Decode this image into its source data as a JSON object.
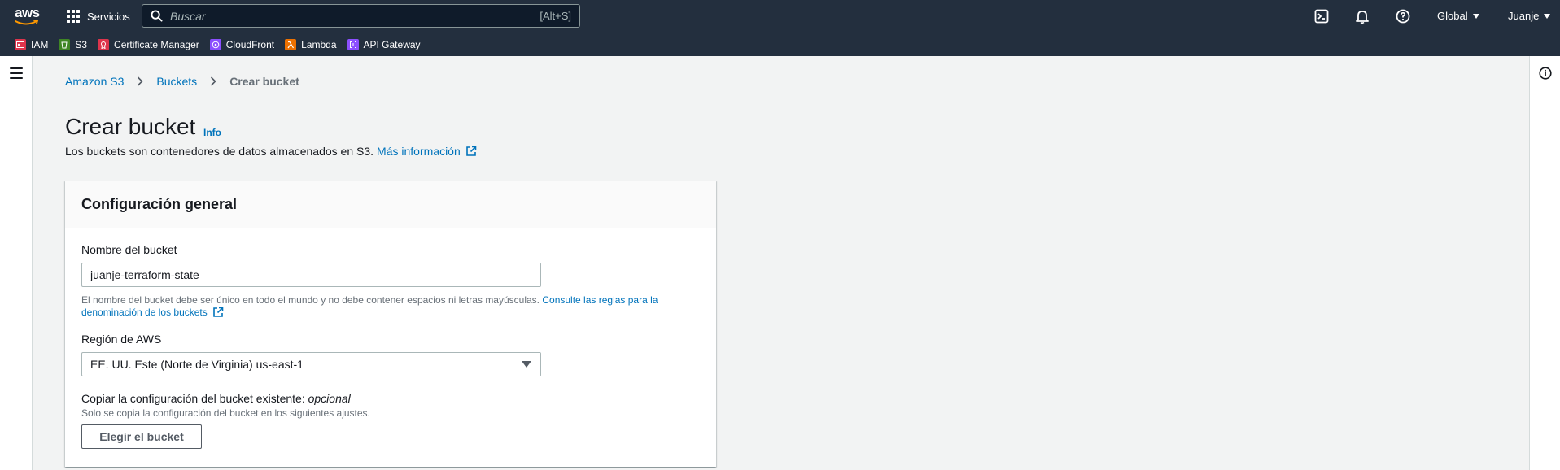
{
  "topnav": {
    "logo": "aws",
    "services_label": "Servicios",
    "search_placeholder": "Buscar",
    "search_shortcut": "[Alt+S]",
    "region": "Global",
    "user": "Juanje"
  },
  "favorites": [
    {
      "label": "IAM",
      "color": "#dd344c",
      "icon": "iam-icon"
    },
    {
      "label": "S3",
      "color": "#3f8624",
      "icon": "s3-icon"
    },
    {
      "label": "Certificate Manager",
      "color": "#dd344c",
      "icon": "certificate-manager-icon"
    },
    {
      "label": "CloudFront",
      "color": "#8c4fff",
      "icon": "cloudfront-icon"
    },
    {
      "label": "Lambda",
      "color": "#ed7100",
      "icon": "lambda-icon"
    },
    {
      "label": "API Gateway",
      "color": "#8c4fff",
      "icon": "api-gateway-icon"
    }
  ],
  "breadcrumb": {
    "item1": "Amazon S3",
    "item2": "Buckets",
    "current": "Crear bucket"
  },
  "header": {
    "title": "Crear bucket",
    "info": "Info",
    "description": "Los buckets son contenedores de datos almacenados en S3.",
    "more_link": "Más información"
  },
  "panel": {
    "title": "Configuración general",
    "bucket_name_label": "Nombre del bucket",
    "bucket_name_value": "juanje-terraform-state",
    "bucket_name_hint": "El nombre del bucket debe ser único en todo el mundo y no debe contener espacios ni letras mayúsculas.",
    "bucket_name_hint_link": "Consulte las reglas para la denominación de los buckets",
    "region_label": "Región de AWS",
    "region_value": "EE. UU. Este (Norte de Virginia) us-east-1",
    "copy_label": "Copiar la configuración del bucket existente:",
    "copy_optional": "opcional",
    "copy_hint": "Solo se copia la configuración del bucket en los siguientes ajustes.",
    "choose_button": "Elegir el bucket"
  },
  "colors": {
    "nav_bg": "#232f3e",
    "link": "#0073bb",
    "page_bg": "#f2f3f3"
  }
}
